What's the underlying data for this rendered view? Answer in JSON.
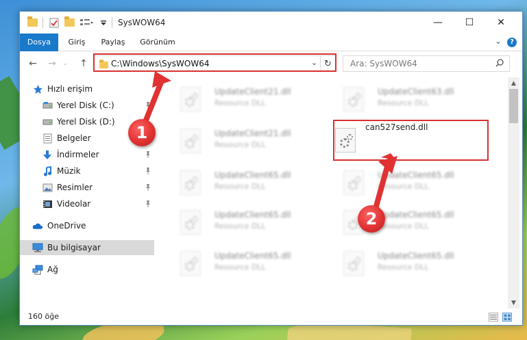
{
  "titlebar": {
    "title": "SysWOW64",
    "minimize": "—",
    "maximize": "☐",
    "close": "✕"
  },
  "ribbon": {
    "tabs": [
      {
        "label": "Dosya",
        "active": true
      },
      {
        "label": "Giriş",
        "active": false
      },
      {
        "label": "Paylaş",
        "active": false
      },
      {
        "label": "Görünüm",
        "active": false
      }
    ],
    "help": "?"
  },
  "navbar": {
    "back": "←",
    "forward": "→",
    "up": "↑",
    "address": "C:\\Windows\\SysWOW64",
    "search_placeholder": "Ara: SysWOW64"
  },
  "sidebar": {
    "items": [
      {
        "label": "Hızlı erişim",
        "icon": "star-icon"
      },
      {
        "label": "Yerel Disk (C:)",
        "icon": "drive-icon"
      },
      {
        "label": "Yerel Disk (D:)",
        "icon": "drive-icon"
      },
      {
        "label": "Belgeler",
        "icon": "document-icon"
      },
      {
        "label": "İndirmeler",
        "icon": "download-icon"
      },
      {
        "label": "Müzik",
        "icon": "music-icon"
      },
      {
        "label": "Resimler",
        "icon": "pictures-icon"
      },
      {
        "label": "Videolar",
        "icon": "video-icon"
      },
      {
        "label": "OneDrive",
        "icon": "cloud-icon"
      },
      {
        "label": "Bu bilgisayar",
        "icon": "computer-icon"
      },
      {
        "label": "Ağ",
        "icon": "network-icon"
      }
    ]
  },
  "files": {
    "left": [
      {
        "name": "UpdateClient21.dll",
        "type": "Resource DLL"
      },
      {
        "name": "UpdateClient21.dll",
        "type": "Resource DLL"
      },
      {
        "name": "UpdateClient65.dll",
        "type": "Resource DLL"
      },
      {
        "name": "UpdateClient65.dll",
        "type": "Resource DLL"
      },
      {
        "name": "UpdateClient65.dll",
        "type": "Resource DLL"
      }
    ],
    "right": [
      {
        "name": "UpdateClient63.dll",
        "type": "Resource DLL"
      },
      {
        "name": "can527send.dll",
        "type": ""
      },
      {
        "name": "UpdateClient65.dll",
        "type": "Resource DLL"
      },
      {
        "name": "UpdateClient65.dll",
        "type": "Resource DLL"
      },
      {
        "name": "UpdateClient65.dll",
        "type": "Resource DLL"
      }
    ]
  },
  "statusbar": {
    "count": "160 öğe"
  },
  "annotations": {
    "marker1": "1",
    "marker2": "2"
  },
  "colors": {
    "accent": "#1979ca",
    "highlight": "#d93030"
  }
}
